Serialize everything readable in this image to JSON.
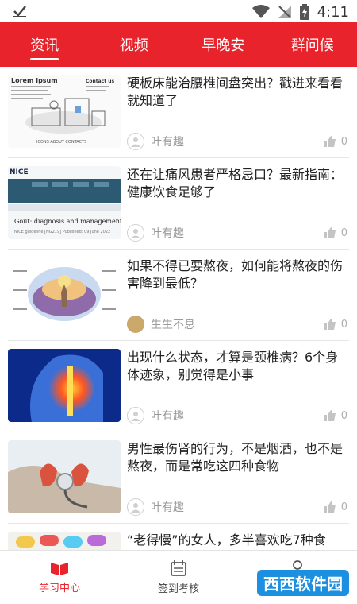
{
  "status_bar": {
    "time": "4:11"
  },
  "tabs": [
    {
      "label": "资讯",
      "active": true
    },
    {
      "label": "视频"
    },
    {
      "label": "早晚安"
    },
    {
      "label": "群问候"
    }
  ],
  "articles": [
    {
      "title": "硬板床能治腰椎间盘突出？戳进来看看就知道了",
      "author": "叶有趣",
      "likes": "0"
    },
    {
      "title": "还在让痛风患者严格忌口？最新指南：健康饮食足够了",
      "author": "叶有趣",
      "likes": "0"
    },
    {
      "title": "如果不得已要熬夜，如何能将熬夜的伤害降到最低？",
      "author": "生生不息",
      "likes": "0"
    },
    {
      "title": "出现什么状态，才算是颈椎病？6个身体迹象，别觉得是小事",
      "author": "叶有趣",
      "likes": "0"
    },
    {
      "title": "男性最伤肾的行为，不是烟酒，也不是熬夜，而是常吃这四种食物",
      "author": "叶有趣",
      "likes": "0"
    },
    {
      "title": "“老得慢”的女人，多半喜欢吃7种食",
      "author": "",
      "likes": ""
    }
  ],
  "thumb_text": {
    "a1_lorem": "Lorem Ipsum",
    "a1_contact": "Contact us",
    "a1_nav": "ICONS   ABOUT   CONTACTS",
    "a2_nice": "NICE",
    "a2_heading": "Gout: diagnosis and management",
    "a2_sub": "NICE guideline [NG219]   Published: 09 June 2022"
  },
  "bottom_nav": [
    {
      "label": "学习中心",
      "active": true
    },
    {
      "label": "签到考核"
    },
    {
      "label": "我的"
    }
  ],
  "watermark": "西西软件园",
  "colors": {
    "brand": "#e8232b",
    "tab_bar": "#e8232b"
  }
}
